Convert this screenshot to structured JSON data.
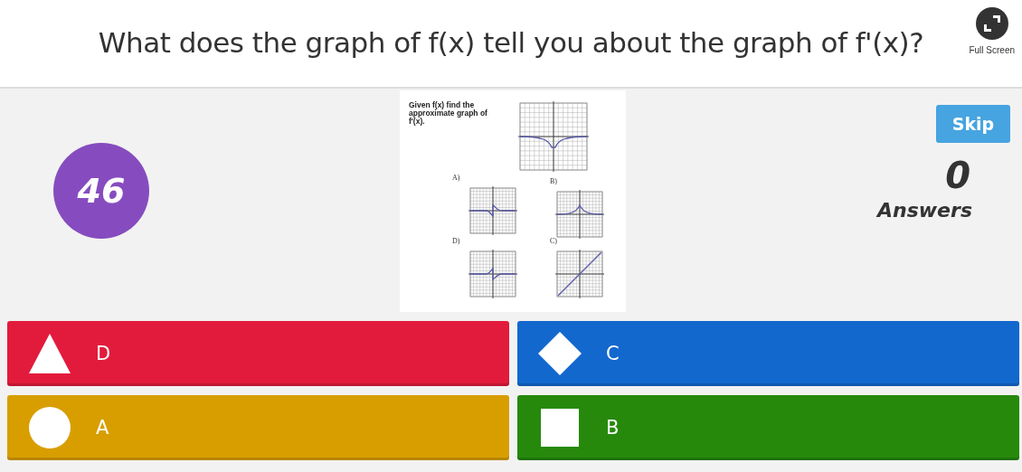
{
  "question": "What does the graph of f(x) tell you about the graph of f'(x)?",
  "fullscreen": {
    "label": "Full Screen"
  },
  "timer": "46",
  "document": {
    "text": "Given f(x) find the approximate graph of f'(x).",
    "graph": {
      "kind": "dip"
    },
    "options": [
      {
        "label": "A)",
        "kind": "odd-down"
      },
      {
        "label": "B)",
        "kind": "bump"
      },
      {
        "label": "D)",
        "kind": "odd-up"
      },
      {
        "label": "C)",
        "kind": "line"
      }
    ]
  },
  "skip": "Skip",
  "answer_count": "0",
  "answer_count_label": "Answers",
  "answers": [
    {
      "kind": "triangle",
      "label": "D",
      "color": "#e21b3c"
    },
    {
      "kind": "diamond",
      "label": "C",
      "color": "#1368ce"
    },
    {
      "kind": "circle",
      "label": "A",
      "color": "#d89e00"
    },
    {
      "kind": "square",
      "label": "B",
      "color": "#26890c"
    }
  ]
}
